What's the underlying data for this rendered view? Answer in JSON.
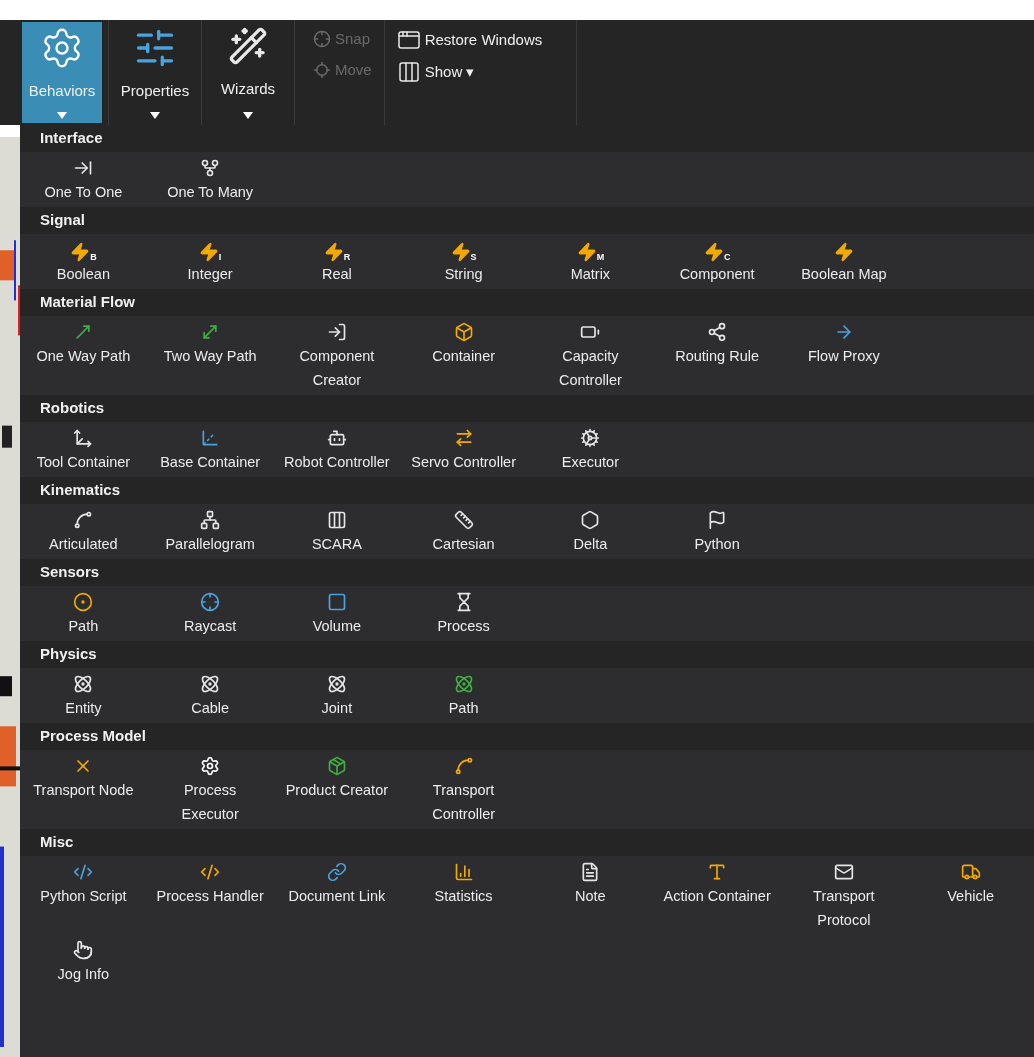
{
  "ribbon": {
    "groups": [
      {
        "label": "Behaviors",
        "selected": true
      },
      {
        "label": "Properties",
        "selected": false
      },
      {
        "label": "Wizards",
        "selected": false
      }
    ],
    "snap_tools": [
      {
        "label": "Snap",
        "disabled": true
      },
      {
        "label": "Move",
        "disabled": true
      }
    ],
    "window_tools": [
      {
        "label": "Restore Windows"
      },
      {
        "label": "Show ▾"
      }
    ]
  },
  "sections": [
    {
      "title": "Interface",
      "items": [
        {
          "label": "One To One"
        },
        {
          "label": "One To Many"
        }
      ]
    },
    {
      "title": "Signal",
      "items": [
        {
          "label": "Boolean",
          "badge": "B"
        },
        {
          "label": "Integer",
          "badge": "I"
        },
        {
          "label": "Real",
          "badge": "R"
        },
        {
          "label": "String",
          "badge": "S"
        },
        {
          "label": "Matrix",
          "badge": "M"
        },
        {
          "label": "Component",
          "badge": "C"
        },
        {
          "label": "Boolean Map"
        }
      ]
    },
    {
      "title": "Material Flow",
      "items": [
        {
          "label": "One Way Path"
        },
        {
          "label": "Two Way Path"
        },
        {
          "label": "Component Creator"
        },
        {
          "label": "Container"
        },
        {
          "label": "Capacity Controller"
        },
        {
          "label": "Routing Rule"
        },
        {
          "label": "Flow Proxy"
        }
      ]
    },
    {
      "title": "Robotics",
      "items": [
        {
          "label": "Tool Container"
        },
        {
          "label": "Base Container"
        },
        {
          "label": "Robot Controller"
        },
        {
          "label": "Servo Controller"
        },
        {
          "label": "Executor"
        }
      ]
    },
    {
      "title": "Kinematics",
      "items": [
        {
          "label": "Articulated"
        },
        {
          "label": "Parallelogram"
        },
        {
          "label": "SCARA"
        },
        {
          "label": "Cartesian"
        },
        {
          "label": "Delta"
        },
        {
          "label": "Python"
        }
      ]
    },
    {
      "title": "Sensors",
      "items": [
        {
          "label": "Path"
        },
        {
          "label": "Raycast"
        },
        {
          "label": "Volume"
        },
        {
          "label": "Process"
        }
      ]
    },
    {
      "title": "Physics",
      "items": [
        {
          "label": "Entity"
        },
        {
          "label": "Cable"
        },
        {
          "label": "Joint"
        },
        {
          "label": "Path"
        }
      ]
    },
    {
      "title": "Process Model",
      "items": [
        {
          "label": "Transport Node"
        },
        {
          "label": "Process Executor"
        },
        {
          "label": "Product Creator"
        },
        {
          "label": "Transport Controller"
        }
      ]
    },
    {
      "title": "Misc",
      "items": [
        {
          "label": "Python Script"
        },
        {
          "label": "Process Handler"
        },
        {
          "label": "Document Link"
        },
        {
          "label": "Statistics"
        },
        {
          "label": "Note"
        },
        {
          "label": "Action Container"
        },
        {
          "label": "Transport Protocol"
        },
        {
          "label": "Vehicle"
        },
        {
          "label": "Jog Info"
        }
      ]
    }
  ]
}
